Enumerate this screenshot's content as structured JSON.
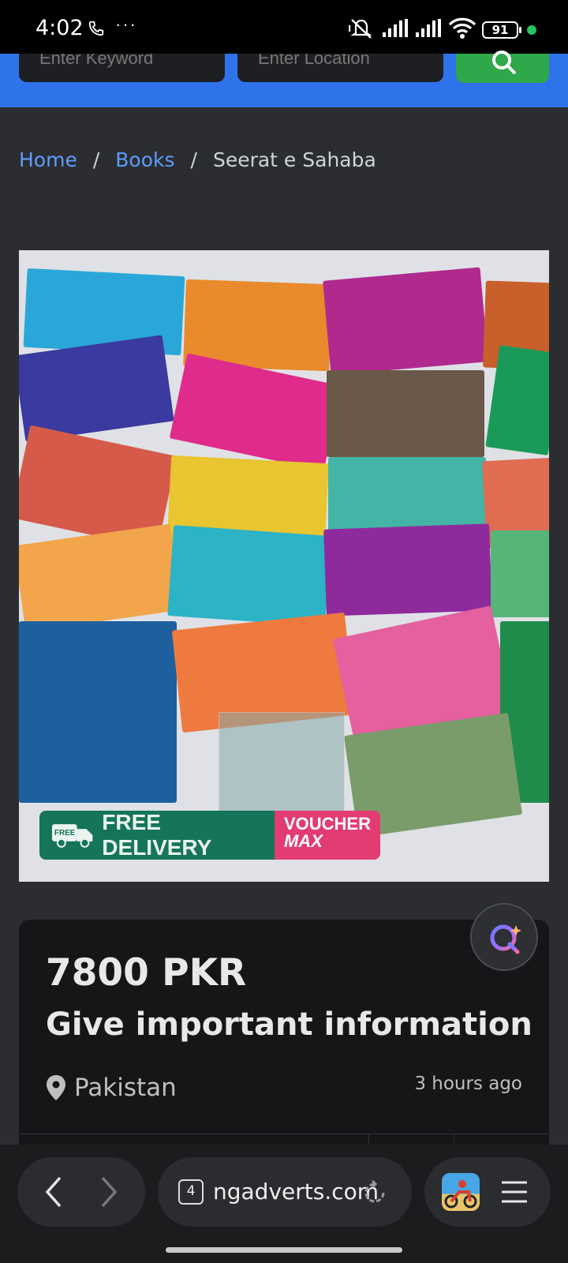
{
  "status": {
    "time": "4:02",
    "more": "···",
    "battery": "91",
    "icons": [
      "phone-icon",
      "more-icon",
      "mute-icon",
      "signal-icon",
      "signal-icon",
      "wifi-icon",
      "battery-icon"
    ]
  },
  "search": {
    "keyword_placeholder": "Enter Keyword",
    "location_placeholder": "Enter Location",
    "search_icon": "search-icon"
  },
  "breadcrumb": {
    "home": "Home",
    "books": "Books",
    "current": "Seerat e Sahaba",
    "separator": "/"
  },
  "image": {
    "badge_delivery": "FREE DELIVERY",
    "badge_voucher_1": "VOUCHER",
    "badge_voucher_2": "MAX",
    "badge_free": "FREE"
  },
  "listing": {
    "price": "7800 PKR",
    "title": "Give important information",
    "location": "Pakistan",
    "posted": "3 hours ago"
  },
  "browser": {
    "tab_count": "4",
    "url": "ngadverts.com",
    "icons": [
      "back-icon",
      "forward-icon",
      "reload-icon",
      "game-app-icon",
      "menu-icon"
    ]
  },
  "colors": {
    "accent_blue": "#2f73ea",
    "search_green": "#2ea84a",
    "link_blue": "#5d9cff",
    "page_bg": "#2b2d30",
    "card_bg": "#151618"
  }
}
